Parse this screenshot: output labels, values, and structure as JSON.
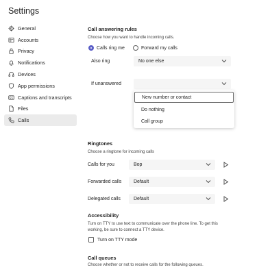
{
  "page": {
    "title": "Settings"
  },
  "sidebar": {
    "items": [
      {
        "label": "General",
        "icon": "gear-icon"
      },
      {
        "label": "Accounts",
        "icon": "accounts-icon"
      },
      {
        "label": "Privacy",
        "icon": "lock-icon"
      },
      {
        "label": "Notifications",
        "icon": "bell-icon"
      },
      {
        "label": "Devices",
        "icon": "headset-icon"
      },
      {
        "label": "App permissions",
        "icon": "shield-icon"
      },
      {
        "label": "Captions and transcripts",
        "icon": "captions-icon"
      },
      {
        "label": "Files",
        "icon": "file-icon"
      },
      {
        "label": "Calls",
        "icon": "phone-icon",
        "active": true
      }
    ]
  },
  "call_answering": {
    "heading": "Call answering rules",
    "description": "Choose how you want to handle incoming calls.",
    "option_ring_me": "Calls ring me",
    "option_forward": "Forward my calls",
    "selected_option": "Calls ring me",
    "also_ring_label": "Also ring",
    "also_ring_value": "No one else",
    "if_unanswered_label": "If unanswered",
    "if_unanswered_value": "",
    "dropdown_options": [
      "New number or contact",
      "Do nothing",
      "Call group"
    ],
    "dropdown_selected": "New number or contact"
  },
  "ringtones": {
    "heading": "Ringtones",
    "description": "Choose a ringtone for incoming calls",
    "rows": [
      {
        "label": "Calls for you",
        "value": "Bop"
      },
      {
        "label": "Forwarded calls",
        "value": "Default"
      },
      {
        "label": "Delegated calls",
        "value": "Default"
      }
    ]
  },
  "accessibility": {
    "heading": "Accessibility",
    "description_line1": "Turn on TTY to use text to communicate over the phone line. To get this",
    "description_line2": "working, be sure to connect a TTY device.",
    "tty_label": "Turn on TTY mode",
    "tty_checked": false
  },
  "call_queues": {
    "heading": "Call queues",
    "description": "Choose whether or not to receive calls for the following queues."
  },
  "colors": {
    "accent": "#5b5fc7",
    "active_nav_bg": "#ebebeb",
    "field_bg": "#f5f5f5"
  }
}
